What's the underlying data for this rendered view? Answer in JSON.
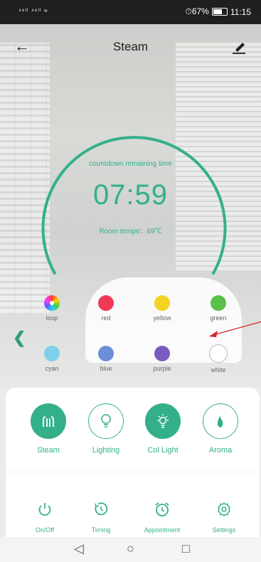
{
  "statusbar": {
    "left": "⁴⁶ˡˡ ⁴⁶ˡˡ ≈",
    "battery": "⏱67%",
    "time": "11:15"
  },
  "header": {
    "title": "Steam"
  },
  "countdown": {
    "label": "countdown remaining time",
    "time": "07:59",
    "room_temp": "Room tempe：69℃",
    "progress_ring_color": "#33b08a"
  },
  "colors": [
    {
      "label": "loop",
      "color": "rainbow"
    },
    {
      "label": "red",
      "color": "#ee3a55"
    },
    {
      "label": "yellow",
      "color": "#f5d321"
    },
    {
      "label": "green",
      "color": "#5bc048"
    },
    {
      "label": "cyan",
      "color": "#7ed0ea"
    },
    {
      "label": "blue",
      "color": "#6c8ed8"
    },
    {
      "label": "purple",
      "color": "#7a5cc0"
    },
    {
      "label": "white",
      "color": "#ffffff"
    }
  ],
  "modes": [
    {
      "label": "Steam",
      "active": true,
      "icon": "steam-icon"
    },
    {
      "label": "Lighting",
      "active": false,
      "icon": "bulb-icon"
    },
    {
      "label": "Col Light",
      "active": true,
      "icon": "sun-bulb-icon"
    },
    {
      "label": "Aroma",
      "active": false,
      "icon": "flame-icon"
    }
  ],
  "tools": [
    {
      "label": "On/Off",
      "icon": "power-icon"
    },
    {
      "label": "Timing",
      "icon": "timer-icon"
    },
    {
      "label": "Appointment",
      "icon": "alarm-clock-icon"
    },
    {
      "label": "Settings",
      "icon": "gear-icon"
    }
  ],
  "accent": "#33b08a"
}
